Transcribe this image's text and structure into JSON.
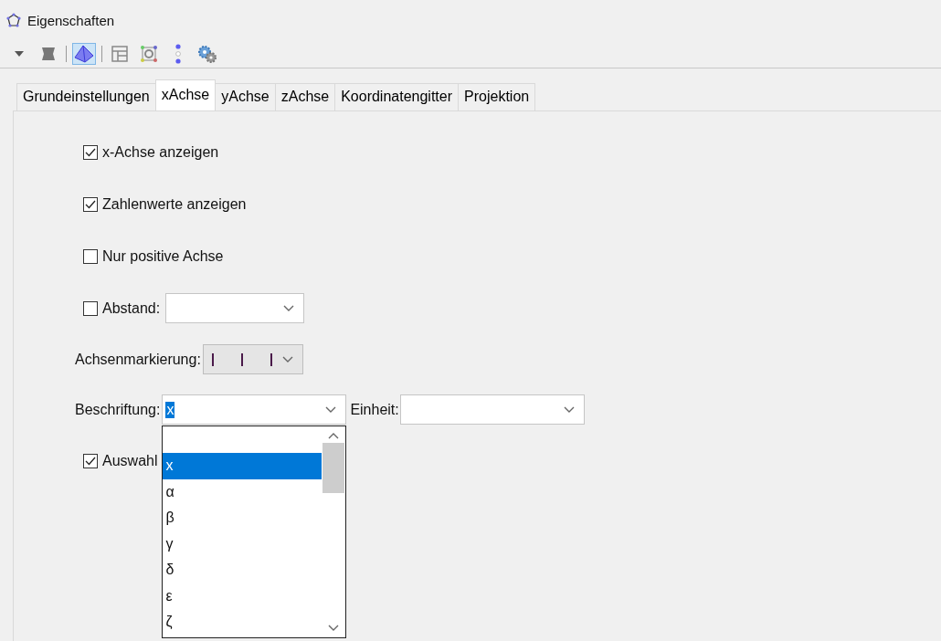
{
  "window": {
    "title": "Eigenschaften"
  },
  "toolbar": {
    "buttons": [
      {
        "kind": "menu",
        "selected": false
      },
      {
        "kind": "square",
        "selected": false
      },
      {
        "kind": "separator"
      },
      {
        "kind": "pyramid",
        "selected": true
      },
      {
        "kind": "separator"
      },
      {
        "kind": "layout",
        "selected": false
      },
      {
        "kind": "frame",
        "selected": false
      },
      {
        "kind": "dots",
        "selected": false
      },
      {
        "kind": "gears",
        "selected": false
      }
    ]
  },
  "tabs": [
    {
      "label": "Grundeinstellungen",
      "selected": false
    },
    {
      "label": "xAchse",
      "selected": true
    },
    {
      "label": "yAchse",
      "selected": false
    },
    {
      "label": "zAchse",
      "selected": false
    },
    {
      "label": "Koordinatengitter",
      "selected": false
    },
    {
      "label": "Projektion",
      "selected": false
    }
  ],
  "options": [
    {
      "kind": "checkbox",
      "label": "x-Achse anzeigen",
      "checked": true
    },
    {
      "kind": "checkbox",
      "label": "Zahlenwerte anzeigen",
      "checked": true
    },
    {
      "kind": "checkbox",
      "label": "Nur positive Achse",
      "checked": false
    },
    {
      "kind": "checkbox-combo",
      "label": "Abstand:",
      "checked": false
    },
    {
      "kind": "tick-combo",
      "label": "Achsenmarkierung:"
    },
    {
      "kind": "label-combo",
      "label": "Beschriftung:",
      "value": "x",
      "unit_label": "Einheit:"
    },
    {
      "kind": "checkbox",
      "label": "Auswahl",
      "checked": true
    }
  ],
  "dropdown": {
    "items": [
      {
        "kind": "blank",
        "selected": false
      },
      {
        "kind": "text",
        "label": "x",
        "selected": true
      },
      {
        "kind": "text",
        "label": "α",
        "selected": false
      },
      {
        "kind": "text",
        "label": "β",
        "selected": false
      },
      {
        "kind": "text",
        "label": "γ",
        "selected": false
      },
      {
        "kind": "text",
        "label": "δ",
        "selected": false
      },
      {
        "kind": "text",
        "label": "ε",
        "selected": false
      },
      {
        "kind": "text",
        "label": "ζ",
        "selected": false
      }
    ]
  }
}
